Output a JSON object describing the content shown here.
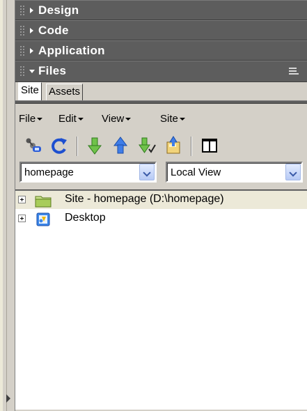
{
  "panel_groups": [
    {
      "title": "Design",
      "expanded": false
    },
    {
      "title": "Code",
      "expanded": false
    },
    {
      "title": "Application",
      "expanded": false
    },
    {
      "title": "Files",
      "expanded": true
    }
  ],
  "tabs": [
    {
      "label": "Site",
      "active": true
    },
    {
      "label": "Assets",
      "active": false
    }
  ],
  "menu": [
    "File",
    "Edit",
    "View",
    "Site"
  ],
  "toolbar": {
    "buttons": [
      {
        "icon": "connect-icon"
      },
      {
        "icon": "refresh-icon"
      },
      {
        "icon": "get-icon"
      },
      {
        "icon": "put-icon"
      },
      {
        "icon": "check-out-icon"
      },
      {
        "icon": "check-in-icon"
      },
      {
        "icon": "expand-icon"
      }
    ]
  },
  "site_select": {
    "value": "homepage"
  },
  "view_select": {
    "value": "Local View"
  },
  "tree": [
    {
      "label": "Site - homepage (D:\\homepage)",
      "icon": "folder-icon"
    },
    {
      "label": "Desktop",
      "icon": "desktop-icon"
    }
  ],
  "colors": {
    "header_bg": "#5d5d5d",
    "panel_bg": "#d4d0c8",
    "tree_bg": "#ffffff",
    "selected_row_bg": "#ece9d8"
  }
}
